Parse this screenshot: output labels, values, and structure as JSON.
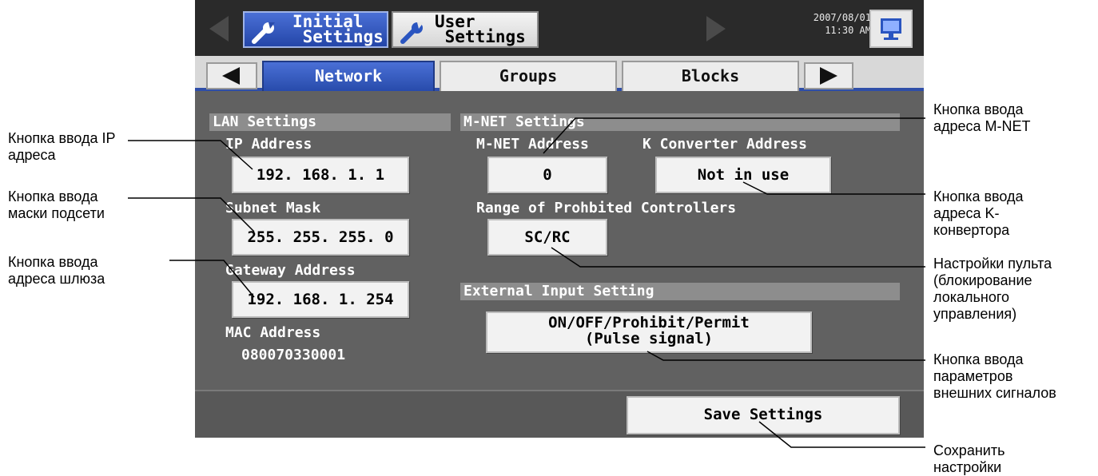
{
  "topbar": {
    "initial_settings_label": "Initial\n Settings",
    "user_settings_label": "User\n Settings",
    "date": "2007/08/01",
    "time": "11:30 AM"
  },
  "tabs": [
    "Network",
    "Groups",
    "Blocks"
  ],
  "lan": {
    "header": "LAN Settings",
    "ip_label": "IP Address",
    "ip_value": "192. 168. 1. 1",
    "subnet_label": "Subnet Mask",
    "subnet_value": "255. 255. 255. 0",
    "gateway_label": "Gateway Address",
    "gateway_value": "192. 168. 1. 254",
    "mac_label": "MAC Address",
    "mac_value": "080070330001"
  },
  "mnet": {
    "header": "M-NET Settings",
    "address_label": "M-NET Address",
    "address_value": "0",
    "k_label": "K Converter Address",
    "k_value": "Not in use",
    "range_label": "Range of Prohbited Controllers",
    "range_value": "SC/RC"
  },
  "external": {
    "header": "External Input Setting",
    "value_line1": "ON/OFF/Prohibit/Permit",
    "value_line2": "(Pulse signal)"
  },
  "save_label": "Save Settings",
  "annotations": {
    "ip": "Кнопка ввода IP\nадреса",
    "subnet": "Кнопка ввода\nмаски подсети",
    "gateway": "Кнопка ввода\nадреса шлюза",
    "mnet": "Кнопка ввода\nадреса M-NET",
    "kconv": "Кнопка ввода\nадреса K-\nконвертора",
    "remote": "Настройки пульта\n(блокирование\nлокального\nуправления)",
    "external": "Кнопка ввода\nпараметров\nвнешних сигналов",
    "save": "Сохранить\nнастройки"
  }
}
